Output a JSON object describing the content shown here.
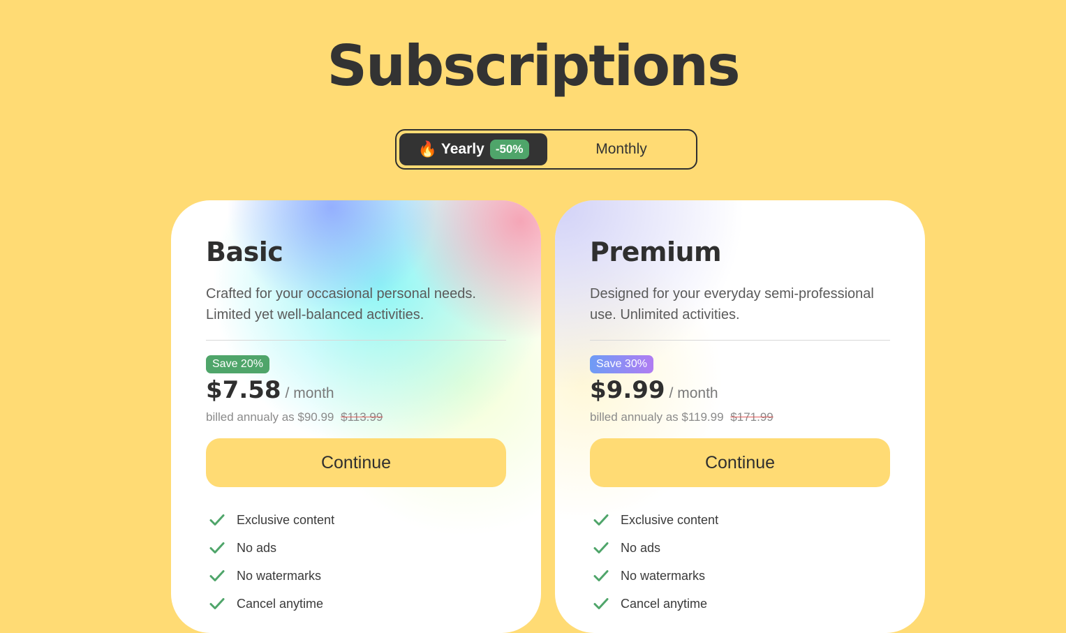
{
  "header": {
    "title": "Subscriptions"
  },
  "billing_toggle": {
    "yearly_label": "Yearly",
    "yearly_icon": "fire-icon",
    "yearly_discount": "-50%",
    "monthly_label": "Monthly",
    "selected": "Yearly"
  },
  "colors": {
    "background": "#FFDB74",
    "toggle_active": "#333333",
    "badge_green": "#4fa56a",
    "check_green": "#4fa56a",
    "strike_red": "#e05a5a"
  },
  "plans": [
    {
      "name": "Basic",
      "description": "Crafted for your occasional personal needs. Limited yet well-balanced activities.",
      "save_badge": "Save 20%",
      "price": "$7.58",
      "period": "/ month",
      "billed_prefix": "billed annualy as $90.99",
      "billed_old": "$113.99",
      "cta": "Continue",
      "features": [
        "Exclusive content",
        "No ads",
        "No watermarks",
        "Cancel anytime"
      ]
    },
    {
      "name": "Premium",
      "description": "Designed for your everyday semi-professional use. Unlimited activities.",
      "save_badge": "Save 30%",
      "price": "$9.99",
      "period": "/ month",
      "billed_prefix": "billed annualy as $119.99",
      "billed_old": "$171.99",
      "cta": "Continue",
      "features": [
        "Exclusive content",
        "No ads",
        "No watermarks",
        "Cancel anytime"
      ]
    }
  ]
}
